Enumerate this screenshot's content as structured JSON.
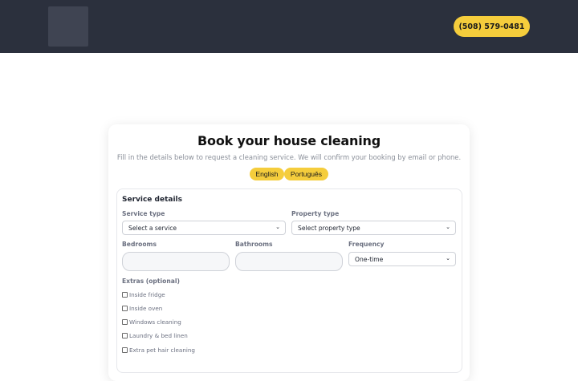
{
  "header": {
    "logo_alt": "logo",
    "phone_label": "(508) 579-0481"
  },
  "booking": {
    "title": "Book your house cleaning",
    "subtitle": "Fill in the details below to request a cleaning service. We will confirm your booking by email or phone.",
    "languages": [
      "English",
      "Português"
    ]
  },
  "service_details": {
    "heading": "Service details",
    "service_type": {
      "label": "Service type",
      "value": "Select a service"
    },
    "property_type": {
      "label": "Property type",
      "value": "Select property type"
    },
    "bedrooms": {
      "label": "Bedrooms",
      "value": ""
    },
    "bathrooms": {
      "label": "Bathrooms",
      "value": ""
    },
    "frequency": {
      "label": "Frequency",
      "value": "One-time"
    },
    "extras_label": "Extras (optional)",
    "extras": [
      {
        "label": "Inside fridge",
        "checked": false
      },
      {
        "label": "Inside oven",
        "checked": false
      },
      {
        "label": "Windows cleaning",
        "checked": false
      },
      {
        "label": "Laundry & bed linen",
        "checked": false
      },
      {
        "label": "Extra pet hair cleaning",
        "checked": false
      }
    ]
  },
  "colors": {
    "header_bg": "#2b303d",
    "accent": "#f5cd3c"
  }
}
